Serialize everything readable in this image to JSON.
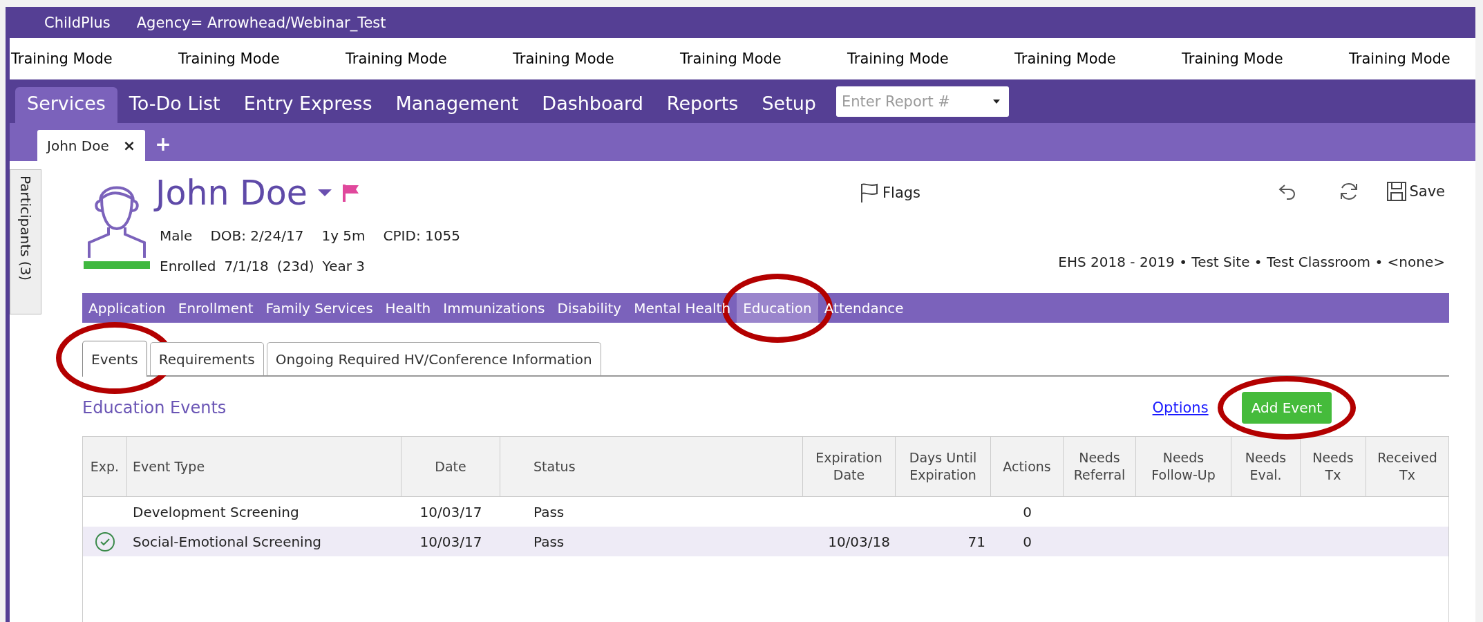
{
  "app": {
    "name": "ChildPlus",
    "agency": "Agency= Arrowhead/Webinar_Test"
  },
  "training_banner": [
    "Training Mode",
    "Training Mode",
    "Training Mode",
    "Training Mode",
    "Training Mode",
    "Training Mode",
    "Training Mode",
    "Training Mode",
    "Training Mode"
  ],
  "main_nav": [
    {
      "label": "Services",
      "selected": true
    },
    {
      "label": "To-Do List",
      "selected": false
    },
    {
      "label": "Entry Express",
      "selected": false
    },
    {
      "label": "Management",
      "selected": false
    },
    {
      "label": "Dashboard",
      "selected": false
    },
    {
      "label": "Reports",
      "selected": false
    },
    {
      "label": "Setup",
      "selected": false
    }
  ],
  "report_field": {
    "placeholder": "Enter Report #"
  },
  "doc_tabs": [
    {
      "label": "John Doe",
      "close": "×",
      "selected": true
    }
  ],
  "new_tab": "+",
  "side_tab": "Participants (3)",
  "participant": {
    "name": "John Doe",
    "flagged": true,
    "details": [
      "Male",
      "DOB: 2/24/17",
      "1y 5m",
      "CPID: 1055"
    ],
    "enrollment": [
      "Enrolled",
      "7/1/18",
      "(23d)",
      "Year 3"
    ],
    "program": "EHS 2018 - 2019 • Test Site • Test Classroom • <none>"
  },
  "header_actions": {
    "flags": "Flags",
    "save": "Save"
  },
  "modules": [
    {
      "label": "Application",
      "selected": false,
      "circled": false
    },
    {
      "label": "Enrollment",
      "selected": false,
      "circled": false
    },
    {
      "label": "Family Services",
      "selected": false,
      "circled": false
    },
    {
      "label": "Health",
      "selected": false,
      "circled": false
    },
    {
      "label": "Immunizations",
      "selected": false,
      "circled": false
    },
    {
      "label": "Disability",
      "selected": false,
      "circled": false
    },
    {
      "label": "Mental Health",
      "selected": false,
      "circled": false
    },
    {
      "label": "Education",
      "selected": true,
      "circled": true
    },
    {
      "label": "Attendance",
      "selected": false,
      "circled": false
    }
  ],
  "subtabs": [
    {
      "label": "Events",
      "selected": true,
      "circled": true
    },
    {
      "label": "Requirements",
      "selected": false,
      "circled": false
    },
    {
      "label": "Ongoing Required HV/Conference Information",
      "selected": false,
      "circled": false
    }
  ],
  "section": {
    "title": "Education Events",
    "options_link": "Options",
    "add_button": {
      "label": "Add Event",
      "circled": true
    }
  },
  "table": {
    "columns": [
      "Exp.",
      "Event Type",
      "Date",
      "Status",
      "Expiration Date",
      "Days Until Expiration",
      "Actions",
      "Needs Referral",
      "Needs Follow-Up",
      "Needs Eval.",
      "Needs Tx",
      "Received Tx"
    ],
    "rows": [
      {
        "checked": false,
        "selected": false,
        "cells": [
          "",
          "Development Screening",
          "10/03/17",
          "Pass",
          "",
          "",
          "0",
          "",
          "",
          "",
          "",
          ""
        ]
      },
      {
        "checked": true,
        "selected": true,
        "cells": [
          "",
          "Social-Emotional Screening",
          "10/03/17",
          "Pass",
          "10/03/18",
          "71",
          "0",
          "",
          "",
          "",
          "",
          ""
        ]
      }
    ]
  }
}
